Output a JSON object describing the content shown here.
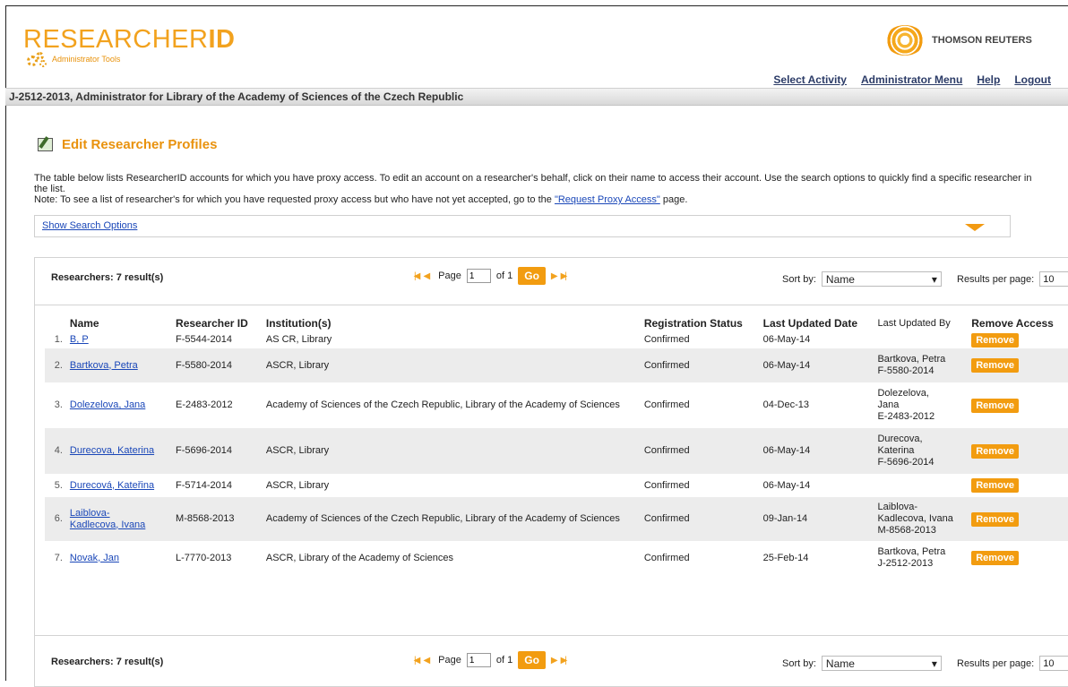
{
  "brand": {
    "logo_main": "RESEARCHER",
    "logo_bold": "ID",
    "logo_sub": "Administrator Tools",
    "partner": "THOMSON REUTERS"
  },
  "topnav": [
    "Select Activity",
    "Administrator Menu",
    "Help",
    "Logout"
  ],
  "admin_bar": "J-2512-2013, Administrator for Library of the Academy of Sciences of the Czech Republic",
  "page_title": "Edit Researcher Profiles",
  "intro": {
    "line1": "The table below lists ResearcherID accounts for which you have proxy access. To edit an account on a researcher's behalf, click on their name to access their account. Use the search options to quickly find a specific researcher in the list.",
    "note_prefix": "Note: To see a list of researcher's for which you have requested proxy access but who have not yet accepted, go to the ",
    "note_link": "\"Request Proxy Access\"",
    "note_suffix": " page."
  },
  "search_options_label": "Show Search Options",
  "pager": {
    "count_label": "Researchers: 7 result(s)",
    "page_label": "Page",
    "page_value": "1",
    "of_label": "of 1",
    "go_label": "Go",
    "sort_label": "Sort by:",
    "sort_value": "Name",
    "rpp_label": "Results per page:",
    "rpp_value": "10"
  },
  "columns": [
    "Name",
    "Researcher ID",
    "Institution(s)",
    "Registration Status",
    "Last Updated Date",
    "Last Updated By",
    "Remove Access"
  ],
  "rows": [
    {
      "n": "1.",
      "name": "B, P",
      "rid": "F-5544-2014",
      "inst": "AS CR, Library",
      "status": "Confirmed",
      "date": "06-May-14",
      "by": "",
      "remove": "Remove"
    },
    {
      "n": "2.",
      "name": "Bartkova, Petra",
      "rid": "F-5580-2014",
      "inst": "ASCR, Library",
      "status": "Confirmed",
      "date": "06-May-14",
      "by": "Bartkova, Petra\nF-5580-2014",
      "remove": "Remove"
    },
    {
      "n": "3.",
      "name": "Dolezelova, Jana",
      "rid": "E-2483-2012",
      "inst": "Academy of Sciences of the Czech Republic, Library of the Academy of Sciences",
      "status": "Confirmed",
      "date": "04-Dec-13",
      "by": "Dolezelova,\nJana\nE-2483-2012",
      "remove": "Remove"
    },
    {
      "n": "4.",
      "name": "Durecova, Katerina",
      "rid": "F-5696-2014",
      "inst": "ASCR, Library",
      "status": "Confirmed",
      "date": "06-May-14",
      "by": "Durecova,\nKaterina\nF-5696-2014",
      "remove": "Remove"
    },
    {
      "n": "5.",
      "name": "Durecová, Kateřina",
      "rid": "F-5714-2014",
      "inst": "ASCR, Library",
      "status": "Confirmed",
      "date": "06-May-14",
      "by": "",
      "remove": "Remove"
    },
    {
      "n": "6.",
      "name": "Laiblova-\nKadlecova, Ivana",
      "rid": "M-8568-2013",
      "inst": "Academy of Sciences of the Czech Republic, Library of the Academy of Sciences",
      "status": "Confirmed",
      "date": "09-Jan-14",
      "by": "Laiblova-\nKadlecova, Ivana\nM-8568-2013",
      "remove": "Remove"
    },
    {
      "n": "7.",
      "name": "Novak, Jan",
      "rid": "L-7770-2013",
      "inst": "ASCR, Library of the Academy of Sciences",
      "status": "Confirmed",
      "date": "25-Feb-14",
      "by": "Bartkova, Petra\nJ-2512-2013",
      "remove": "Remove"
    }
  ]
}
